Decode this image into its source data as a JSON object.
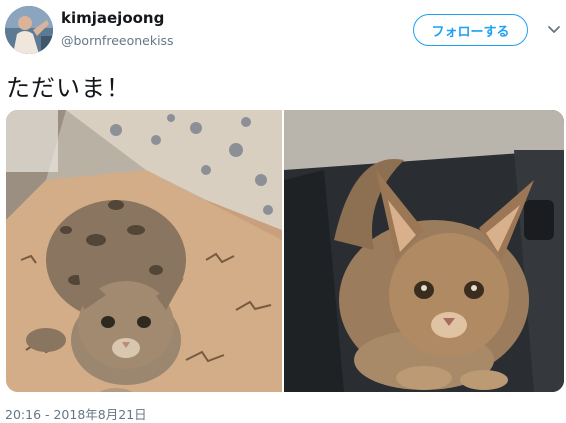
{
  "author": {
    "display_name": "kimjaejoong",
    "handle": "@bornfreeonekiss"
  },
  "follow_button_label": "フォローする",
  "tweet": {
    "text": "ただいま！",
    "timestamp": "20:16 - 2018年8月21日"
  },
  "icons": [
    "chevron-down-icon"
  ],
  "colors": {
    "accent": "#1da1f2",
    "secondary_text": "#657786",
    "primary_text": "#14171a"
  }
}
